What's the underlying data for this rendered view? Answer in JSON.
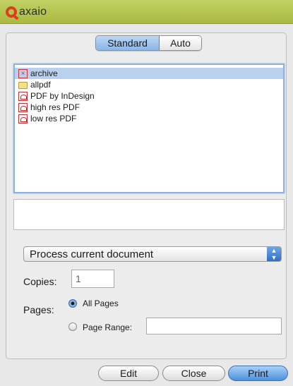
{
  "app": {
    "name": "axaio",
    "brand_color": "#b5c44f",
    "accent_color": "#d9411e"
  },
  "tabs": {
    "standard": "Standard",
    "auto": "Auto",
    "active": "Standard"
  },
  "list": {
    "items": [
      {
        "label": "archive",
        "icon": "x-icon",
        "selected": true
      },
      {
        "label": "allpdf",
        "icon": "folder-icon",
        "selected": false
      },
      {
        "label": "PDF by InDesign",
        "icon": "pdf-icon",
        "selected": false
      },
      {
        "label": "high res PDF",
        "icon": "pdf-icon",
        "selected": false
      },
      {
        "label": "low res PDF",
        "icon": "pdf-icon",
        "selected": false
      }
    ]
  },
  "mode_select": {
    "value": "Process current document"
  },
  "copies": {
    "label": "Copies:",
    "value": "1"
  },
  "pages": {
    "label": "Pages:",
    "all_label": "All Pages",
    "range_label": "Page Range:",
    "range_value": "",
    "selected": "All Pages"
  },
  "buttons": {
    "edit": "Edit",
    "close": "Close",
    "print": "Print"
  }
}
